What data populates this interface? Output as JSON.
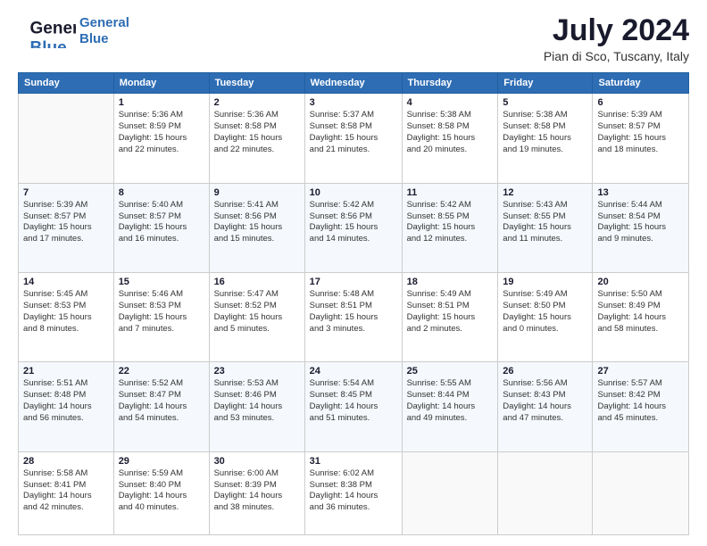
{
  "logo": {
    "line1": "General",
    "line2": "Blue"
  },
  "header": {
    "month_year": "July 2024",
    "location": "Pian di Sco, Tuscany, Italy"
  },
  "days_of_week": [
    "Sunday",
    "Monday",
    "Tuesday",
    "Wednesday",
    "Thursday",
    "Friday",
    "Saturday"
  ],
  "weeks": [
    [
      {
        "day": "",
        "info": ""
      },
      {
        "day": "1",
        "info": "Sunrise: 5:36 AM\nSunset: 8:59 PM\nDaylight: 15 hours\nand 22 minutes."
      },
      {
        "day": "2",
        "info": "Sunrise: 5:36 AM\nSunset: 8:58 PM\nDaylight: 15 hours\nand 22 minutes."
      },
      {
        "day": "3",
        "info": "Sunrise: 5:37 AM\nSunset: 8:58 PM\nDaylight: 15 hours\nand 21 minutes."
      },
      {
        "day": "4",
        "info": "Sunrise: 5:38 AM\nSunset: 8:58 PM\nDaylight: 15 hours\nand 20 minutes."
      },
      {
        "day": "5",
        "info": "Sunrise: 5:38 AM\nSunset: 8:58 PM\nDaylight: 15 hours\nand 19 minutes."
      },
      {
        "day": "6",
        "info": "Sunrise: 5:39 AM\nSunset: 8:57 PM\nDaylight: 15 hours\nand 18 minutes."
      }
    ],
    [
      {
        "day": "7",
        "info": "Sunrise: 5:39 AM\nSunset: 8:57 PM\nDaylight: 15 hours\nand 17 minutes."
      },
      {
        "day": "8",
        "info": "Sunrise: 5:40 AM\nSunset: 8:57 PM\nDaylight: 15 hours\nand 16 minutes."
      },
      {
        "day": "9",
        "info": "Sunrise: 5:41 AM\nSunset: 8:56 PM\nDaylight: 15 hours\nand 15 minutes."
      },
      {
        "day": "10",
        "info": "Sunrise: 5:42 AM\nSunset: 8:56 PM\nDaylight: 15 hours\nand 14 minutes."
      },
      {
        "day": "11",
        "info": "Sunrise: 5:42 AM\nSunset: 8:55 PM\nDaylight: 15 hours\nand 12 minutes."
      },
      {
        "day": "12",
        "info": "Sunrise: 5:43 AM\nSunset: 8:55 PM\nDaylight: 15 hours\nand 11 minutes."
      },
      {
        "day": "13",
        "info": "Sunrise: 5:44 AM\nSunset: 8:54 PM\nDaylight: 15 hours\nand 9 minutes."
      }
    ],
    [
      {
        "day": "14",
        "info": "Sunrise: 5:45 AM\nSunset: 8:53 PM\nDaylight: 15 hours\nand 8 minutes."
      },
      {
        "day": "15",
        "info": "Sunrise: 5:46 AM\nSunset: 8:53 PM\nDaylight: 15 hours\nand 7 minutes."
      },
      {
        "day": "16",
        "info": "Sunrise: 5:47 AM\nSunset: 8:52 PM\nDaylight: 15 hours\nand 5 minutes."
      },
      {
        "day": "17",
        "info": "Sunrise: 5:48 AM\nSunset: 8:51 PM\nDaylight: 15 hours\nand 3 minutes."
      },
      {
        "day": "18",
        "info": "Sunrise: 5:49 AM\nSunset: 8:51 PM\nDaylight: 15 hours\nand 2 minutes."
      },
      {
        "day": "19",
        "info": "Sunrise: 5:49 AM\nSunset: 8:50 PM\nDaylight: 15 hours\nand 0 minutes."
      },
      {
        "day": "20",
        "info": "Sunrise: 5:50 AM\nSunset: 8:49 PM\nDaylight: 14 hours\nand 58 minutes."
      }
    ],
    [
      {
        "day": "21",
        "info": "Sunrise: 5:51 AM\nSunset: 8:48 PM\nDaylight: 14 hours\nand 56 minutes."
      },
      {
        "day": "22",
        "info": "Sunrise: 5:52 AM\nSunset: 8:47 PM\nDaylight: 14 hours\nand 54 minutes."
      },
      {
        "day": "23",
        "info": "Sunrise: 5:53 AM\nSunset: 8:46 PM\nDaylight: 14 hours\nand 53 minutes."
      },
      {
        "day": "24",
        "info": "Sunrise: 5:54 AM\nSunset: 8:45 PM\nDaylight: 14 hours\nand 51 minutes."
      },
      {
        "day": "25",
        "info": "Sunrise: 5:55 AM\nSunset: 8:44 PM\nDaylight: 14 hours\nand 49 minutes."
      },
      {
        "day": "26",
        "info": "Sunrise: 5:56 AM\nSunset: 8:43 PM\nDaylight: 14 hours\nand 47 minutes."
      },
      {
        "day": "27",
        "info": "Sunrise: 5:57 AM\nSunset: 8:42 PM\nDaylight: 14 hours\nand 45 minutes."
      }
    ],
    [
      {
        "day": "28",
        "info": "Sunrise: 5:58 AM\nSunset: 8:41 PM\nDaylight: 14 hours\nand 42 minutes."
      },
      {
        "day": "29",
        "info": "Sunrise: 5:59 AM\nSunset: 8:40 PM\nDaylight: 14 hours\nand 40 minutes."
      },
      {
        "day": "30",
        "info": "Sunrise: 6:00 AM\nSunset: 8:39 PM\nDaylight: 14 hours\nand 38 minutes."
      },
      {
        "day": "31",
        "info": "Sunrise: 6:02 AM\nSunset: 8:38 PM\nDaylight: 14 hours\nand 36 minutes."
      },
      {
        "day": "",
        "info": ""
      },
      {
        "day": "",
        "info": ""
      },
      {
        "day": "",
        "info": ""
      }
    ]
  ]
}
